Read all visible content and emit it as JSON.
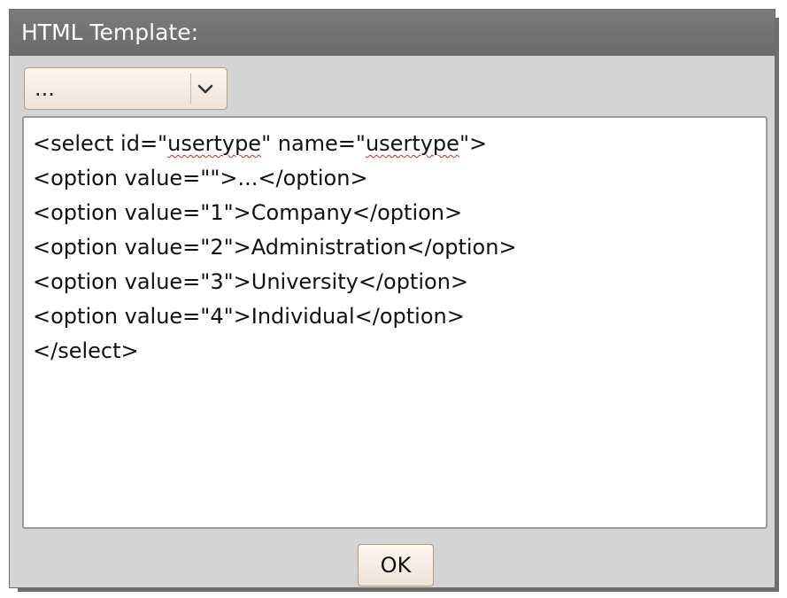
{
  "dialog": {
    "title": "HTML Template:"
  },
  "select": {
    "selected": "..."
  },
  "editor": {
    "lines": [
      {
        "pre": "<select id=\"",
        "w1": "usertype",
        "mid": "\" name=\"",
        "w2": "usertype",
        "post": "\">"
      },
      "<option value=\"\">...</option>",
      "<option value=\"1\">Company</option>",
      "<option value=\"2\">Administration</option>",
      "<option value=\"3\">University</option>",
      "<option value=\"4\">Individual</option>",
      "</select>"
    ]
  },
  "buttons": {
    "ok_label": "OK"
  },
  "icons": {
    "dropdown": "chevron-down-icon"
  },
  "colors": {
    "titlebar": "#6e6e6e",
    "dialog_bg": "#d4d4d4",
    "button_border": "#b49a7e",
    "spell_underline": "#e02020"
  }
}
